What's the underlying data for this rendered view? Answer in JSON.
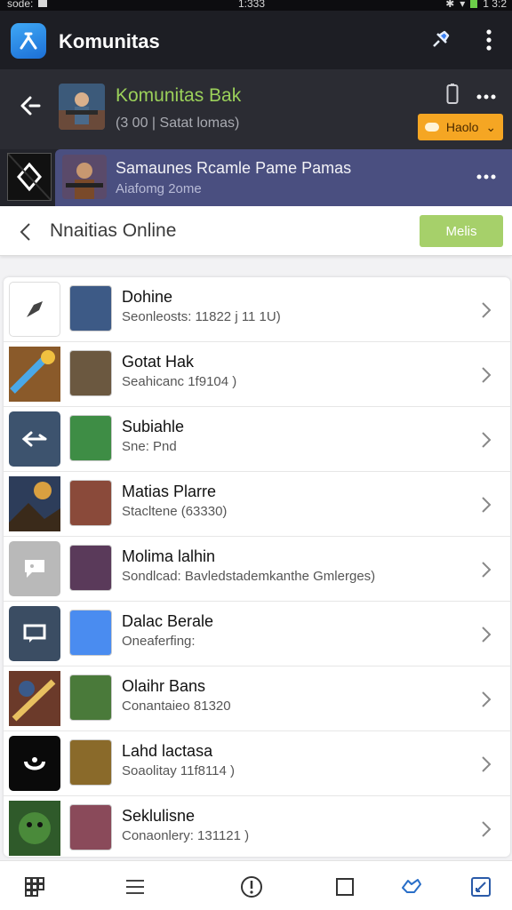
{
  "status": {
    "left_text": "sode:",
    "time": "1:333",
    "right_text": "1 3:2"
  },
  "app": {
    "title": "Komunitas"
  },
  "game": {
    "title": "Komunitas Bak",
    "subtitle": "(3 00 | Satat lomas)",
    "button_label": "Haolo"
  },
  "group": {
    "title": "Samaunes Rcamle Pame Pamas",
    "subtitle": "Aiafomg 2ome"
  },
  "section": {
    "title": "Nnaitias Online",
    "button_label": "Melis"
  },
  "list": [
    {
      "name": "Dohine",
      "meta": "Seonleosts: 11822 j 11 1U)",
      "big_icon": "arrow-icon",
      "big_bg": "#ffffff",
      "sm_color": "#3d5a86"
    },
    {
      "name": "Gotat Hak",
      "meta": "Seahicanc 1f9104 )",
      "big_icon": "weapon-art",
      "big_bg": "#8a5a2a",
      "sm_color": "#6b5840"
    },
    {
      "name": "Subiahle",
      "meta": "Sne: Pnd",
      "big_icon": "swap-arrows-icon",
      "big_bg": "#3d536e",
      "sm_color": "#3e8d45"
    },
    {
      "name": "Matias Plarre",
      "meta": "Stacltene (63330)",
      "big_icon": "scene-art",
      "big_bg": "#2d3d5a",
      "sm_color": "#8a4a3a"
    },
    {
      "name": "Molima lalhin",
      "meta": "Sondlcad: Bavledstademkanthe Gmlerges)",
      "big_icon": "chat-bubble-icon",
      "big_bg": "#b9b9b9",
      "sm_color": "#5a3a5a"
    },
    {
      "name": "Dalac Berale",
      "meta": "Oneaferfing:",
      "big_icon": "message-icon",
      "big_bg": "#3b4d63",
      "sm_color": "#4a8cf0"
    },
    {
      "name": "Olaihr Bans",
      "meta": "Conantaieo 81320",
      "big_icon": "battle-art",
      "big_bg": "#6b3a2a",
      "sm_color": "#4a7a3a"
    },
    {
      "name": "Lahd lactasa",
      "meta": "Soaolitay 11f8114 )",
      "big_icon": "swirl-icon",
      "big_bg": "#0a0a0a",
      "sm_color": "#8a6a2a"
    },
    {
      "name": "Seklulisne",
      "meta": "Conaonlery: 131121 )",
      "big_icon": "creature-art",
      "big_bg": "#2f5a2a",
      "sm_color": "#8a4a5a"
    }
  ],
  "bottom_nav": [
    {
      "icon": "grid-icon"
    },
    {
      "icon": "menu-icon"
    },
    {
      "icon": "alert-icon"
    },
    {
      "icon": "square-icon"
    },
    {
      "icon": "hand-icon"
    },
    {
      "icon": "edit-icon"
    }
  ]
}
